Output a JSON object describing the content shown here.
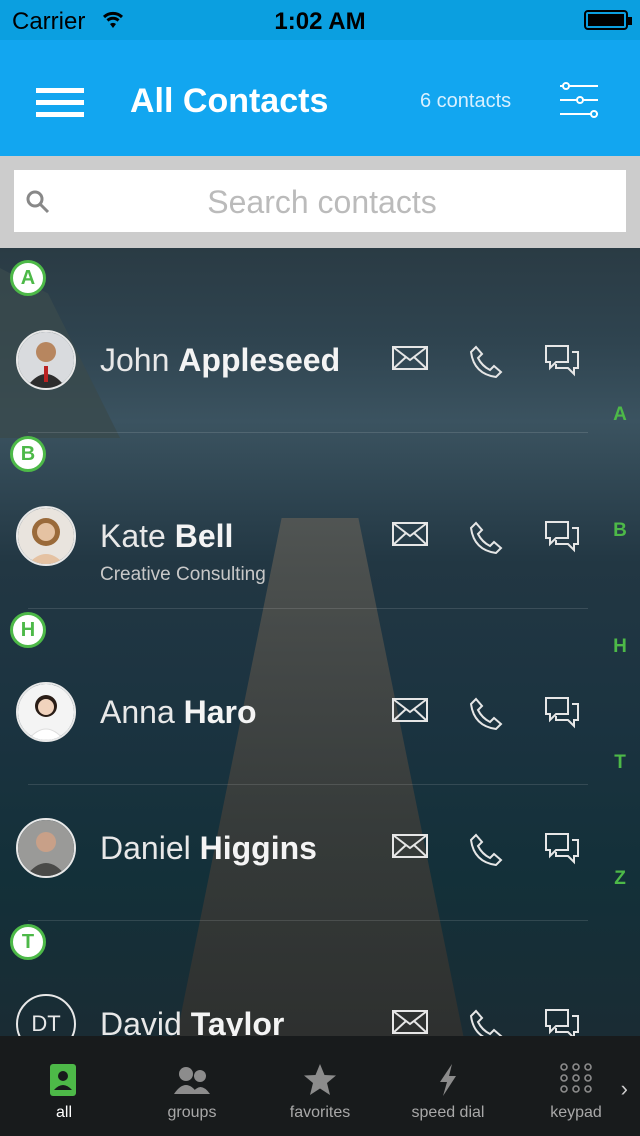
{
  "status_bar": {
    "carrier": "Carrier",
    "time": "1:02 AM"
  },
  "header": {
    "title": "All Contacts",
    "count": "6 contacts"
  },
  "search": {
    "placeholder": "Search contacts"
  },
  "sections": [
    "A",
    "B",
    "H",
    "T"
  ],
  "contacts": [
    {
      "first": "John",
      "last": "Appleseed",
      "subtitle": "",
      "initials": ""
    },
    {
      "first": "Kate",
      "last": "Bell",
      "subtitle": "Creative Consulting",
      "initials": ""
    },
    {
      "first": "Anna",
      "last": "Haro",
      "subtitle": "",
      "initials": ""
    },
    {
      "first": "Daniel",
      "last": "Higgins",
      "subtitle": "",
      "initials": ""
    },
    {
      "first": "David",
      "last": "Taylor",
      "subtitle": "",
      "initials": "DT"
    }
  ],
  "index_letters": [
    "A",
    "B",
    "H",
    "T",
    "Z"
  ],
  "tabs": [
    {
      "label": "all",
      "icon": "contacts-icon"
    },
    {
      "label": "groups",
      "icon": "groups-icon"
    },
    {
      "label": "favorites",
      "icon": "star-icon"
    },
    {
      "label": "speed dial",
      "icon": "lightning-icon"
    },
    {
      "label": "keypad",
      "icon": "keypad-icon"
    }
  ],
  "colors": {
    "accent": "#12a6f0",
    "section_green": "#4db948",
    "tab_active": "#4db948"
  }
}
